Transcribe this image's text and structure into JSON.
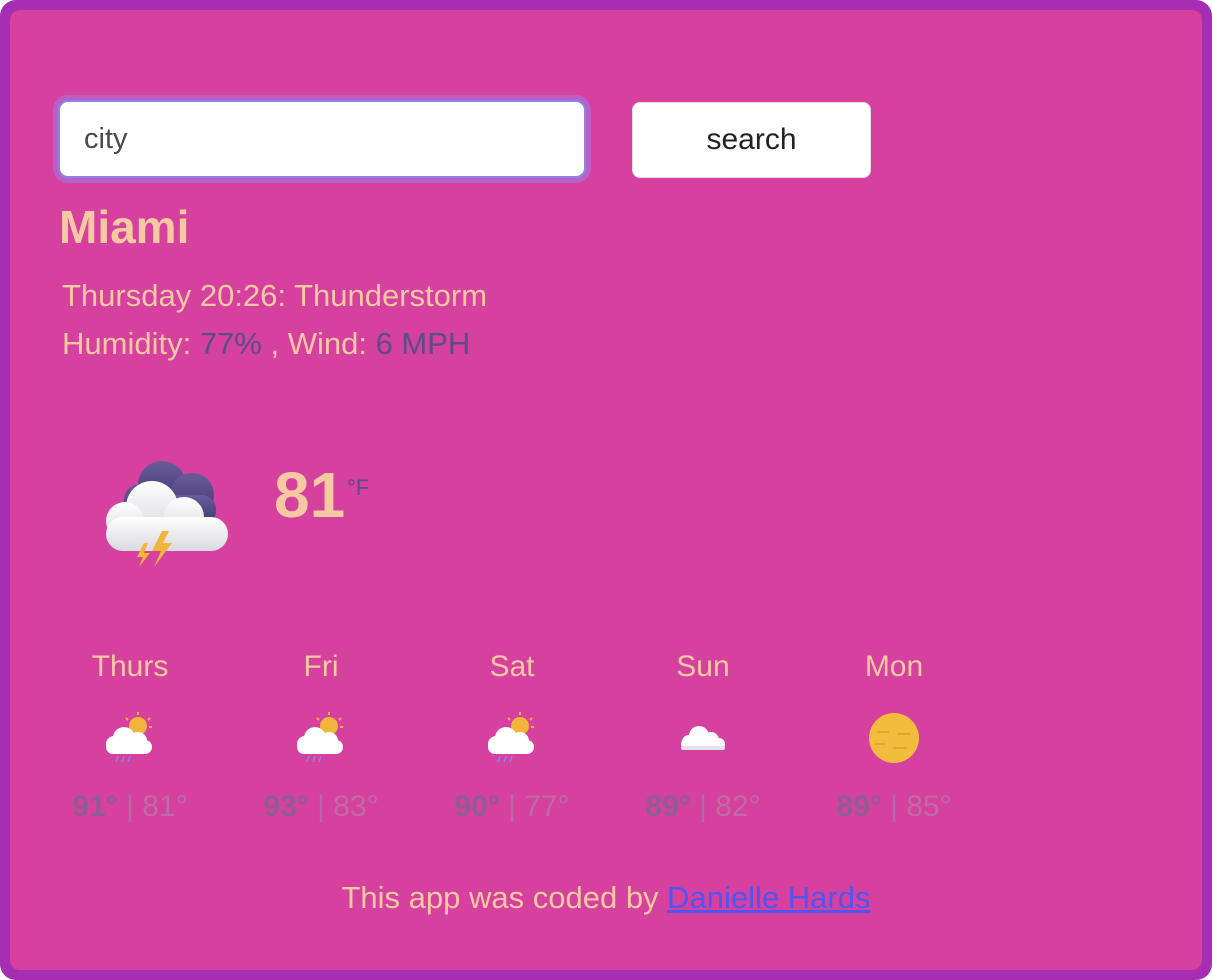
{
  "search": {
    "placeholder": "city",
    "button_label": "search"
  },
  "current": {
    "city": "Miami",
    "day_time_prefix": "Thursday 20:26: ",
    "condition": "Thunderstorm",
    "humidity_label": "Humidity: ",
    "humidity_value": "77%",
    "wind_label": " , Wind: ",
    "wind_value": "6 MPH",
    "temperature": "81",
    "unit": "°F",
    "icon": "thunderstorm-icon"
  },
  "forecast": [
    {
      "day": "Thurs",
      "icon": "partly-cloudy-rain-icon",
      "max": "91°",
      "min": "81°"
    },
    {
      "day": "Fri",
      "icon": "partly-cloudy-rain-icon",
      "max": "93°",
      "min": "83°"
    },
    {
      "day": "Sat",
      "icon": "partly-cloudy-rain-icon",
      "max": "90°",
      "min": "77°"
    },
    {
      "day": "Sun",
      "icon": "cloud-icon",
      "max": "89°",
      "min": "82°"
    },
    {
      "day": "Mon",
      "icon": "hazy-sun-icon",
      "max": "89°",
      "min": "85°"
    }
  ],
  "separator": " | ",
  "footer": {
    "text": "This app was coded by ",
    "link_text": "Danielle Hards"
  },
  "colors": {
    "frame": "#a52eb3",
    "card": "#d6409f",
    "accent_text": "#f6c9a2",
    "value_text": "#5a4e86",
    "link": "#4f55f0"
  }
}
